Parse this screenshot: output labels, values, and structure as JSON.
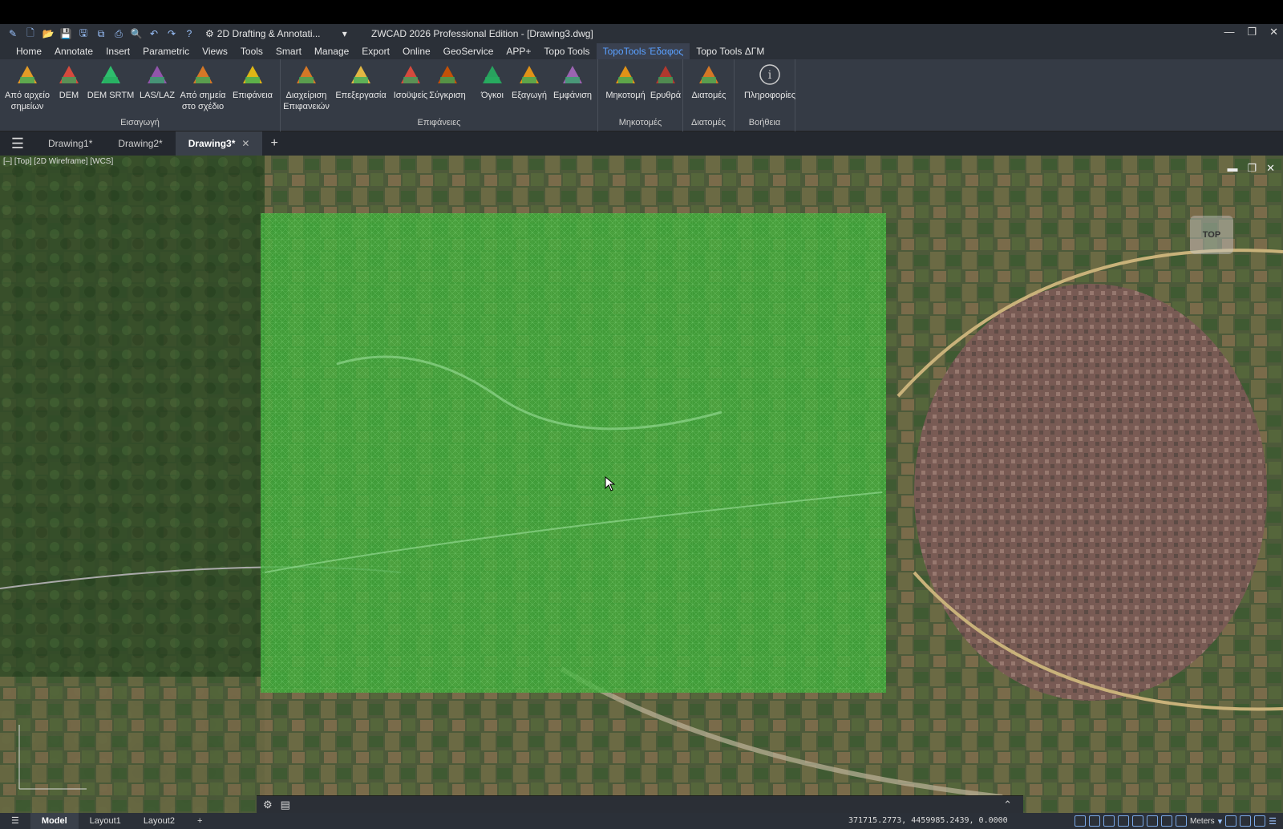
{
  "titlebar": {
    "workspace": "2D Drafting & Annotati...",
    "title": "ZWCAD 2026 Professional Edition - [Drawing3.dwg]"
  },
  "menu": {
    "items": [
      "Home",
      "Annotate",
      "Insert",
      "Parametric",
      "Views",
      "Tools",
      "Smart",
      "Manage",
      "Export",
      "Online",
      "GeoService",
      "APP+",
      "Topo Tools",
      "TopoTools Έδαφος",
      "Topo Tools ΔΓΜ"
    ],
    "active_index": 13
  },
  "ribbon": {
    "groups": [
      {
        "label": "Εισαγωγή",
        "buttons": [
          "Από αρχείο\nσημείων",
          "DEM",
          "DEM SRTM",
          "LAS/LAZ",
          "Από σημεία\nστο σχέδιο",
          "Επιφάνεια"
        ]
      },
      {
        "label": "Επιφάνειες",
        "buttons": [
          "Διαχείριση\nΕπιφανειών",
          "Επεξεργασία",
          "Ισοϋψείς",
          "Σύγκριση",
          "Όγκοι",
          "Εξαγωγή",
          "Εμφάνιση"
        ]
      },
      {
        "label": "Μηκοτομές",
        "buttons": [
          "Μηκοτομή",
          "Ερυθρά"
        ]
      },
      {
        "label": "Διατομές",
        "buttons": [
          "Διατομές"
        ]
      },
      {
        "label": "Βοήθεια",
        "buttons": [
          "Πληροφορίες"
        ]
      }
    ]
  },
  "doc_tabs": [
    {
      "label": "Drawing1*"
    },
    {
      "label": "Drawing2*"
    },
    {
      "label": "Drawing3*",
      "active": true
    }
  ],
  "viewport": {
    "label": "[–] [Top] [2D Wireframe] [WCS]",
    "viewcube": "TOP"
  },
  "status": {
    "tabs": [
      "Model",
      "Layout1",
      "Layout2"
    ],
    "coords": "371715.2773, 4459985.2439, 0.0000",
    "units": "Meters"
  },
  "colors": {
    "accent": "#5aa0ff",
    "surface_overlay": "#3fae3a"
  }
}
